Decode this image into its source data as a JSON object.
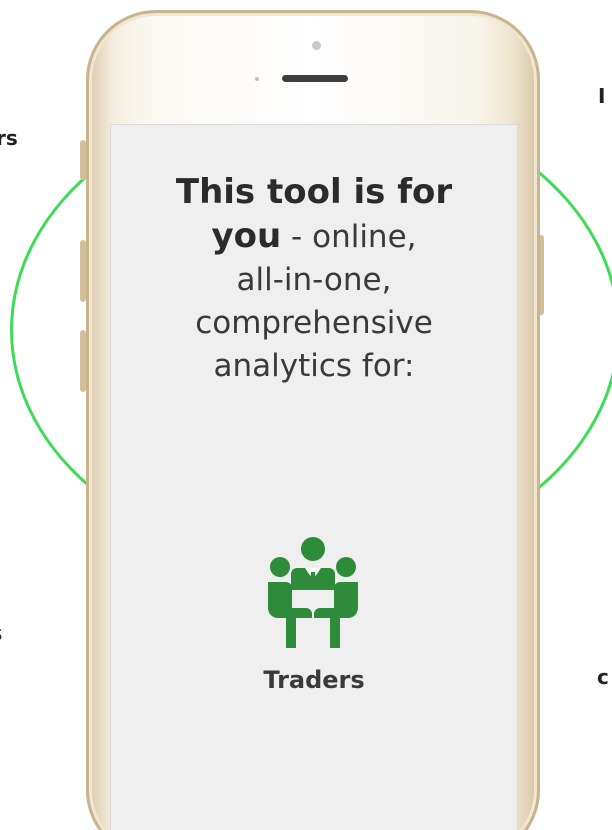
{
  "side_labels": {
    "top_left": "rs",
    "bottom_left": "s",
    "top_right": "I",
    "bottom_right": "c"
  },
  "screen": {
    "headline_bold_1": "This tool is for",
    "headline_bold_2": "you",
    "headline_rest_1": " - online,",
    "headline_line_3": "all-in-one,",
    "headline_line_4": "comprehensive",
    "headline_line_5": "analytics for:",
    "icon": "people-meeting-icon",
    "caption": "Traders"
  },
  "colors": {
    "ring": "#3ddc55",
    "icon": "#2e8b3a",
    "text": "#3a3a3a"
  }
}
